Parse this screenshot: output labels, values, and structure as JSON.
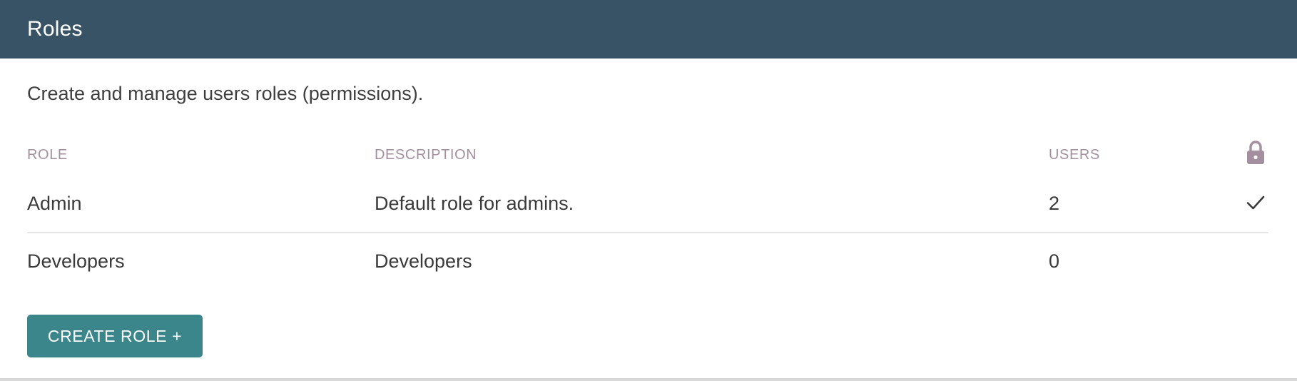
{
  "header": {
    "title": "Roles"
  },
  "intro": {
    "text": "Create and manage users roles (permissions)."
  },
  "table": {
    "columns": {
      "role": "ROLE",
      "description": "DESCRIPTION",
      "users": "USERS",
      "locked_icon": "lock-icon"
    },
    "rows": [
      {
        "role": "Admin",
        "description": "Default role for admins.",
        "users": "2",
        "locked": true
      },
      {
        "role": "Developers",
        "description": "Developers",
        "users": "0",
        "locked": false
      }
    ]
  },
  "actions": {
    "create_role_label": "CREATE ROLE +"
  },
  "colors": {
    "header_bg": "#385366",
    "button_bg": "#3a868a",
    "column_header_text": "#a48f9f"
  }
}
